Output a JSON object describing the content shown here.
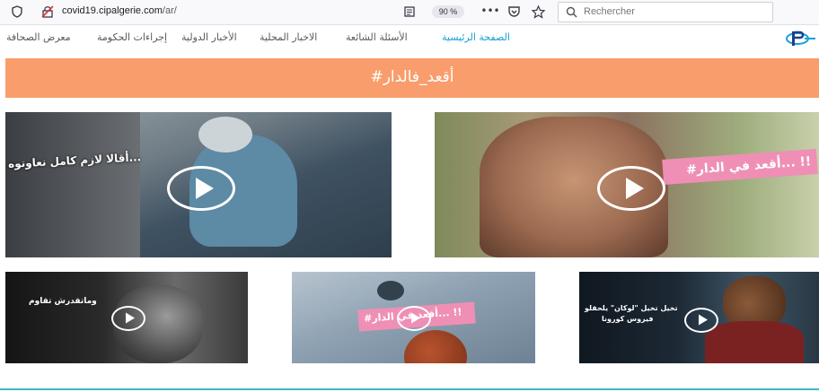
{
  "browser": {
    "url_host": "covid19.cipalgerie.com",
    "url_path": "/ar/",
    "zoom": "90 %",
    "search_placeholder": "Rechercher",
    "icons": [
      "shield-icon",
      "connection-icon",
      "reader-icon",
      "more-icon",
      "pocket-icon",
      "star-icon",
      "search-icon"
    ]
  },
  "nav": {
    "items": [
      {
        "label": "الصفحة الرئيسية",
        "active": true
      },
      {
        "label": "الأسئلة الشائعة",
        "active": false
      },
      {
        "label": "الاخبار المحلية",
        "active": false
      },
      {
        "label": "الأخبار الدولية",
        "active": false
      },
      {
        "label": "إجراءات الحكومة",
        "active": false
      },
      {
        "label": "معرض الصحافة",
        "active": false
      }
    ]
  },
  "banner": {
    "text": "#أقعد_فالدار",
    "color": "#f99d6c"
  },
  "videos": [
    {
      "caption": "أقالا لازم كامل نعاونوه..."
    },
    {
      "caption": "#أقعد في الدار... !!"
    },
    {
      "caption": "وماتقدرش تقاوم"
    },
    {
      "caption": "#أقعد في الدار... !!"
    },
    {
      "caption_line1": "تخيل تخيل \"لوكان\" يلحقلو",
      "caption_line2": "فيروس كورونا"
    }
  ],
  "colors": {
    "accent": "#1aa0d7",
    "play": "#ffffff",
    "pink_tag": "#ef8fb5"
  }
}
